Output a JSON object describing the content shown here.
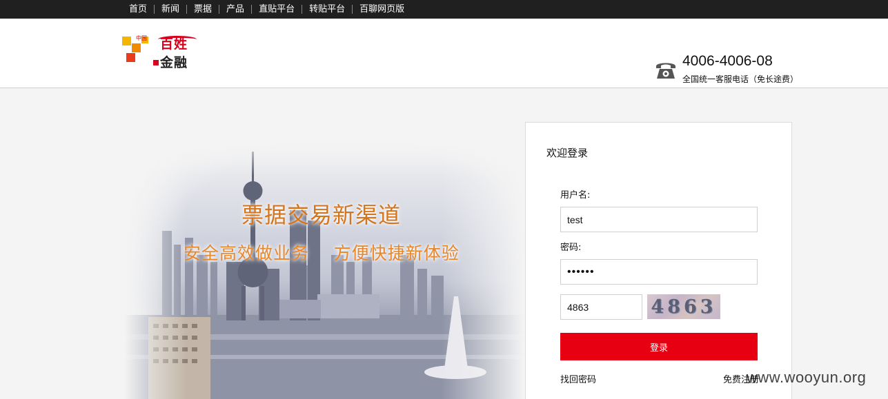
{
  "topnav": {
    "items": [
      "首页",
      "新闻",
      "票据",
      "产品",
      "直贴平台",
      "转贴平台",
      "百聊网页版"
    ]
  },
  "header": {
    "logo": {
      "small_text": "中国",
      "line1": "百姓",
      "line2": "金融",
      "colors": [
        "#f5b400",
        "#f08a00",
        "#e83c1c",
        "#d8001c"
      ]
    },
    "phone_icon": "telephone-icon",
    "phone_number": "4006-4006-08",
    "phone_subtitle": "全国统一客服电话（免长途费）"
  },
  "banner": {
    "slogan_main": "票据交易新渠道",
    "slogan_sub": "安全高效做业务    方便快捷新体验"
  },
  "login": {
    "title": "欢迎登录",
    "username_label": "用户名:",
    "username_value": "test",
    "password_label": "密码:",
    "password_value": "••••••",
    "captcha_value": "4863",
    "captcha_image_text": "4863",
    "submit_label": "登录",
    "forgot_link": "找回密码",
    "register_link": "免费注册",
    "accent_color": "#e60012"
  },
  "watermark": "www.wooyun.org"
}
